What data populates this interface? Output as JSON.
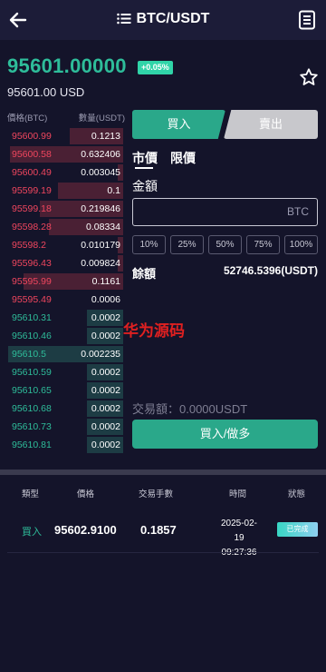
{
  "header": {
    "title": "BTC/USDT"
  },
  "ticker": {
    "price": "95601.00000",
    "change": "+0.05%",
    "price_usd": "95601.00 USD"
  },
  "orderbook": {
    "col_price": "價格(BTC)",
    "col_qty": "數量(USDT)",
    "sells": [
      {
        "price": "95600.99",
        "qty": "0.1213",
        "depth": 0.46
      },
      {
        "price": "95600.58",
        "qty": "0.632406",
        "depth": 0.98
      },
      {
        "price": "95600.49",
        "qty": "0.003045",
        "depth": 0.05
      },
      {
        "price": "95599.19",
        "qty": "0.1",
        "depth": 0.56
      },
      {
        "price": "95599.18",
        "qty": "0.219846",
        "depth": 0.72
      },
      {
        "price": "95598.28",
        "qty": "0.08334",
        "depth": 0.64
      },
      {
        "price": "95598.2",
        "qty": "0.010179",
        "depth": 0.05
      },
      {
        "price": "95596.43",
        "qty": "0.009824",
        "depth": 0.05
      },
      {
        "price": "95595.99",
        "qty": "0.1161",
        "depth": 0.86
      },
      {
        "price": "95595.49",
        "qty": "0.0006",
        "depth": 0.0
      }
    ],
    "buys": [
      {
        "price": "95610.31",
        "qty": "0.0002",
        "depth": 0.31
      },
      {
        "price": "95610.46",
        "qty": "0.0002",
        "depth": 0.31
      },
      {
        "price": "95610.5",
        "qty": "0.002235",
        "depth": 0.99
      },
      {
        "price": "95610.59",
        "qty": "0.0002",
        "depth": 0.31
      },
      {
        "price": "95610.65",
        "qty": "0.0002",
        "depth": 0.31
      },
      {
        "price": "95610.68",
        "qty": "0.0002",
        "depth": 0.31
      },
      {
        "price": "95610.73",
        "qty": "0.0002",
        "depth": 0.31
      },
      {
        "price": "95610.81",
        "qty": "0.0002",
        "depth": 0.31
      }
    ]
  },
  "watermark": "华为源码",
  "trade": {
    "tab_buy": "買入",
    "tab_sell": "賣出",
    "type_market": "市價",
    "type_limit": "限價",
    "amount_label": "金額",
    "amount_value": "",
    "amount_unit": "BTC",
    "percents": [
      "10%",
      "25%",
      "50%",
      "75%",
      "100%"
    ],
    "balance_label": "餘額",
    "balance_value": "52746.5396(USDT)",
    "trade_amount": "交易額：0.0000USDT",
    "submit": "買入/做多"
  },
  "history": {
    "headers": [
      "類型",
      "價格",
      "交易手數",
      "時間",
      "狀態"
    ],
    "rows": [
      {
        "type": "買入",
        "price": "95602.9100",
        "fee": "0.1857",
        "date": "2025-02-19",
        "time": "09:27:36",
        "status": "已完成"
      }
    ]
  },
  "colors": {
    "up": "#2ebd9a",
    "down": "#f0465e",
    "background": "#14142a"
  }
}
